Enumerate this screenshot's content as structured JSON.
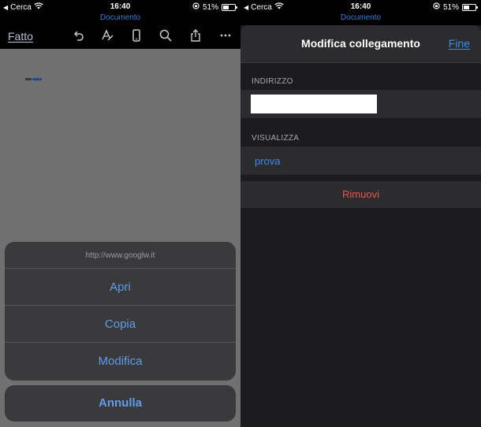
{
  "status": {
    "carrier": "Cerca",
    "time": "16:40",
    "battery": "51%",
    "battery_level": 0.51
  },
  "left": {
    "doc_label": "Documento",
    "toolbar": {
      "done_label": "Fatto",
      "icons": [
        "undo-icon",
        "pen-icon",
        "phone-view-icon",
        "search-icon",
        "share-icon",
        "more-icon"
      ]
    },
    "action_sheet": {
      "url": "http://www.googlw.it",
      "open_label": "Apri",
      "copy_label": "Copia",
      "edit_label": "Modifica",
      "cancel_label": "Annulla"
    }
  },
  "right": {
    "doc_label": "Documento",
    "modal": {
      "title": "Modifica collegamento",
      "done_label": "Fine",
      "address_label": "INDIRIZZO",
      "address_value": "",
      "display_label": "VISUALIZZA",
      "display_value": "prova",
      "remove_label": "Rimuovi"
    }
  },
  "colors": {
    "accent": "#3c8ef0",
    "destructive": "#e5544d",
    "doc_label": "#3c7ed8"
  }
}
